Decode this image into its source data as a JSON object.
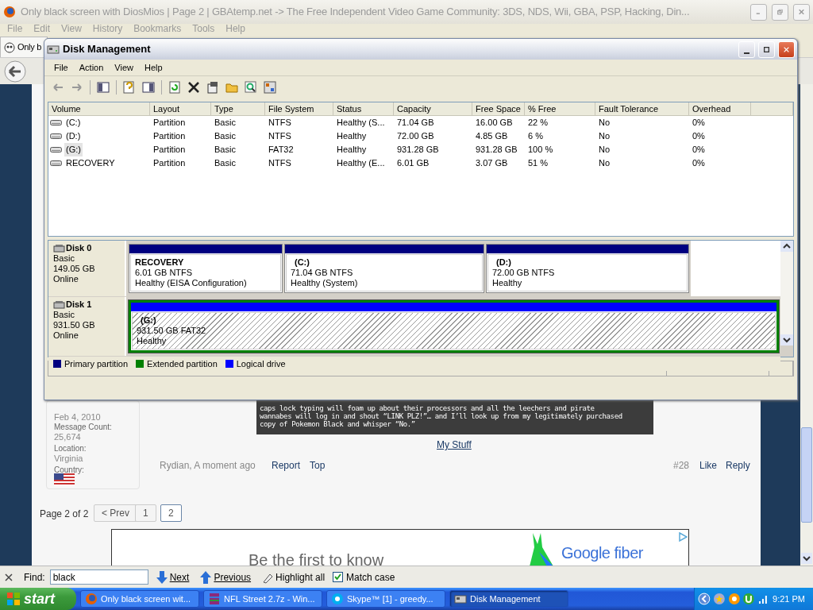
{
  "browser": {
    "title": "Only black screen with DiosMios | Page 2 | GBAtemp.net -> The Free Independent Video Game Community: 3DS, NDS, Wii, GBA, PSP, Hacking, Din...",
    "menu": [
      "File",
      "Edit",
      "View",
      "History",
      "Bookmarks",
      "Tools",
      "Help"
    ],
    "tab": "Only b",
    "page": {
      "member_since": "Feb 4, 2010",
      "profile": [
        {
          "label": "Message Count:",
          "value": "25,674"
        },
        {
          "label": "Location:",
          "value": "Virginia"
        },
        {
          "label": "Country:"
        }
      ],
      "code_lines": [
        "caps lock typing will foam up about their processors and all the leechers and pirate",
        "wannabes will log in and shout “LINK PLZ!”… and I’ll look up from my legitimately purchased",
        "copy of Pokemon Black and whisper “No.”"
      ],
      "signature": "My Stuff",
      "byline": "Rydian, A moment ago",
      "post_links": [
        "Report",
        "Top"
      ],
      "post_number": "#28",
      "post_actions": [
        "Like",
        "Reply"
      ],
      "page_label": "Page 2 of 2",
      "pages": [
        {
          "label": "< Prev",
          "selected": false
        },
        {
          "label": "1",
          "selected": false
        },
        {
          "label": "2",
          "selected": true
        }
      ],
      "ad": {
        "headline": "Be the first to know",
        "brand": "Google fiber"
      }
    },
    "find": {
      "label": "Find:",
      "value": "black",
      "next": "Next",
      "previous": "Previous",
      "highlight": "Highlight all",
      "match_case": {
        "label": "Match case",
        "checked": true
      }
    }
  },
  "disk_management": {
    "title": "Disk Management",
    "menu": [
      "File",
      "Action",
      "View",
      "Help"
    ],
    "columns": [
      "Volume",
      "Layout",
      "Type",
      "File System",
      "Status",
      "Capacity",
      "Free Space",
      "% Free",
      "Fault Tolerance",
      "Overhead"
    ],
    "rows": [
      {
        "selected": false,
        "cells": [
          "(C:)",
          "Partition",
          "Basic",
          "NTFS",
          "Healthy (S...",
          "71.04 GB",
          "16.00 GB",
          "22 %",
          "No",
          "0%"
        ]
      },
      {
        "selected": false,
        "cells": [
          "(D:)",
          "Partition",
          "Basic",
          "NTFS",
          "Healthy",
          "72.00 GB",
          "4.85 GB",
          "6 %",
          "No",
          "0%"
        ]
      },
      {
        "selected": true,
        "cells": [
          "(G:)",
          "Partition",
          "Basic",
          "FAT32",
          "Healthy",
          "931.28 GB",
          "931.28 GB",
          "100 %",
          "No",
          "0%"
        ]
      },
      {
        "selected": false,
        "cells": [
          "RECOVERY",
          "Partition",
          "Basic",
          "NTFS",
          "Healthy (E...",
          "6.01 GB",
          "3.07 GB",
          "51 %",
          "No",
          "0%"
        ]
      }
    ],
    "disks": [
      {
        "name": "Disk 0",
        "type": "Basic",
        "size": "149.05 GB",
        "status": "Online",
        "partitions": [
          {
            "kind": "primary",
            "selected": false,
            "label": "RECOVERY",
            "size": "6.01 GB NTFS",
            "status": "Healthy (EISA Configuration)"
          },
          {
            "kind": "primary",
            "selected": false,
            "label": "(C:)",
            "size": "71.04 GB NTFS",
            "status": "Healthy (System)"
          },
          {
            "kind": "primary",
            "selected": false,
            "label": "(D:)",
            "size": "72.00 GB NTFS",
            "status": "Healthy"
          }
        ]
      },
      {
        "name": "Disk 1",
        "type": "Basic",
        "size": "931.50 GB",
        "status": "Online",
        "partitions": [
          {
            "kind": "logical",
            "selected": true,
            "label": "(G:)",
            "size": "931.50 GB FAT32",
            "status": "Healthy"
          }
        ]
      }
    ],
    "legend": [
      {
        "label": "Primary partition",
        "color": "#000080"
      },
      {
        "label": "Extended partition",
        "color": "#008000"
      },
      {
        "label": "Logical drive",
        "color": "#0000ff"
      }
    ]
  },
  "taskbar": {
    "start": "start",
    "items": [
      {
        "label": "Only black screen wit...",
        "selected": false
      },
      {
        "label": "NFL Street 2.7z - Win...",
        "selected": false
      },
      {
        "label": "Skype™ [1] - greedy...",
        "selected": false
      },
      {
        "label": "Disk Management",
        "selected": true
      }
    ],
    "clock": "9:21 PM"
  }
}
